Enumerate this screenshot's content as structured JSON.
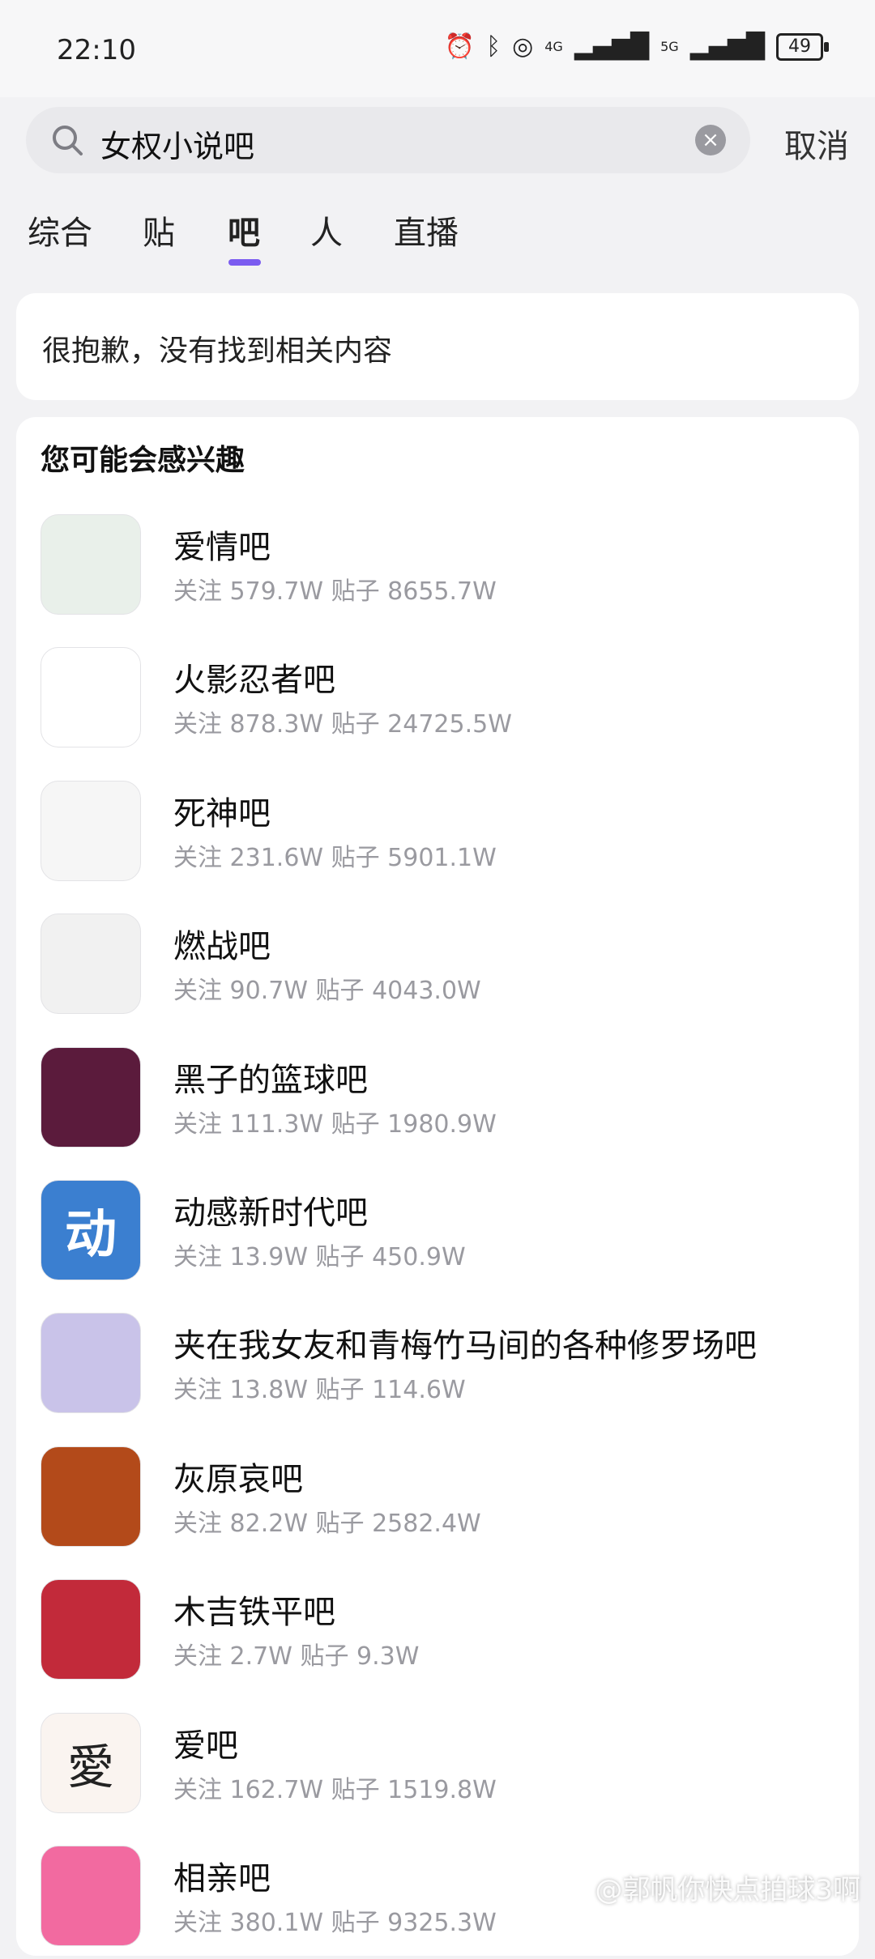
{
  "status_bar": {
    "time": "22:10",
    "network_1": "4G",
    "network_2": "5G",
    "battery": "49"
  },
  "search": {
    "query": "女权小说吧",
    "cancel_label": "取消"
  },
  "tabs": [
    "综合",
    "贴",
    "吧",
    "人",
    "直播"
  ],
  "active_tab": "吧",
  "empty_message": "很抱歉，没有找到相关内容",
  "suggestions": {
    "heading": "您可能会感兴趣",
    "items": [
      {
        "name": "爱情吧",
        "stats": "关注 579.7W 贴子 8655.7W",
        "avatar_color": "#e9f0ea"
      },
      {
        "name": "火影忍者吧",
        "stats": "关注 878.3W 贴子 24725.5W",
        "avatar_color": "#ffffff"
      },
      {
        "name": "死神吧",
        "stats": "关注 231.6W 贴子 5901.1W",
        "avatar_color": "#f6f6f6"
      },
      {
        "name": "燃战吧",
        "stats": "关注 90.7W 贴子 4043.0W",
        "avatar_color": "#f1f1f1"
      },
      {
        "name": "黑子的篮球吧",
        "stats": "关注 111.3W 贴子 1980.9W",
        "avatar_color": "#5b1b3c"
      },
      {
        "name": "动感新时代吧",
        "stats": "关注 13.9W 贴子 450.9W",
        "avatar_color": "#3b7fd0"
      },
      {
        "name": "夹在我女友和青梅竹马间的各种修罗场吧",
        "stats": "关注 13.8W 贴子 114.6W",
        "avatar_color": "#c9c3e9"
      },
      {
        "name": "灰原哀吧",
        "stats": "关注 82.2W 贴子 2582.4W",
        "avatar_color": "#b34a1a"
      },
      {
        "name": "木吉铁平吧",
        "stats": "关注 2.7W 贴子 9.3W",
        "avatar_color": "#c22a3a"
      },
      {
        "name": "爱吧",
        "stats": "关注 162.7W 贴子 1519.8W",
        "avatar_color": "#faf4f0"
      },
      {
        "name": "相亲吧",
        "stats": "关注 380.1W 贴子 9325.3W",
        "avatar_color": "#f26aa0"
      }
    ]
  },
  "watermark": "@郭帆你快点拍球3啊"
}
